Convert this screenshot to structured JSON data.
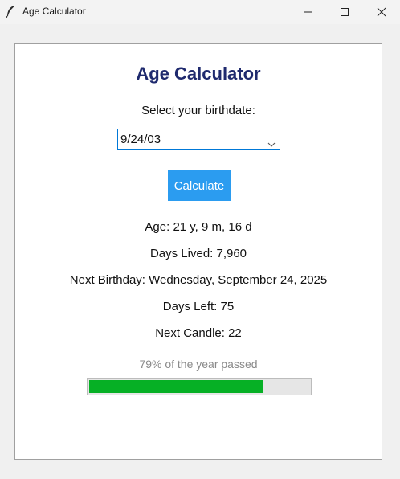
{
  "window": {
    "title": "Age Calculator"
  },
  "app": {
    "heading": "Age Calculator",
    "prompt": "Select your birthdate:",
    "birthdate_value": "9/24/03",
    "calculate_label": "Calculate",
    "accent_color": "#2b9cf0",
    "heading_color": "#1f2a6e"
  },
  "results": {
    "age": "Age: 21 y, 9 m, 16 d",
    "days_lived": "Days Lived: 7,960",
    "next_birthday": "Next Birthday: Wednesday, September 24, 2025",
    "days_left": "Days Left: 75",
    "next_candle": "Next Candle: 22"
  },
  "progress": {
    "label": "79% of the year passed",
    "fraction": 0.79,
    "fill_color": "#06b025"
  },
  "icons": {
    "app": "feather-icon",
    "minimize": "minimize-icon",
    "maximize": "maximize-icon",
    "close": "close-icon",
    "dropdown": "chevron-down-icon"
  }
}
